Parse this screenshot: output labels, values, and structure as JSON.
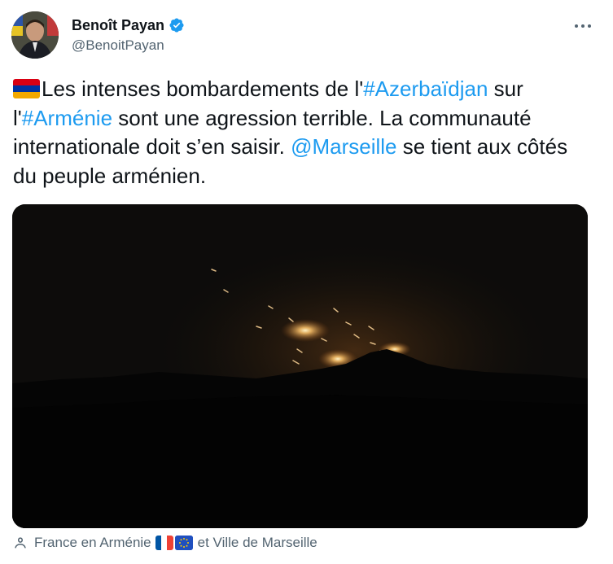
{
  "author": {
    "display_name": "Benoît Payan",
    "handle": "@BenoitPayan",
    "verified": true
  },
  "tweet": {
    "segments": [
      {
        "text": "Les intenses bombardements de l'",
        "kind": "text"
      },
      {
        "text": "#Azerbaïdjan",
        "kind": "hashtag"
      },
      {
        "text": " sur l'",
        "kind": "text"
      },
      {
        "text": "#Arménie",
        "kind": "hashtag"
      },
      {
        "text": " sont une agression terrible. La communauté internationale doit s’en saisir. ",
        "kind": "text"
      },
      {
        "text": "@Marseille",
        "kind": "mention"
      },
      {
        "text": " se tient aux côtés du peuple arménien.",
        "kind": "text"
      }
    ]
  },
  "tagged": {
    "first": "France en Arménie",
    "second": "et Ville de Marseille"
  },
  "colors": {
    "link": "#1d9bf0",
    "secondary_text": "#536471",
    "verified": "#1d9bf0",
    "flag_armenia": [
      "#d90012",
      "#0033a0",
      "#f2a800"
    ],
    "flag_france": [
      "#0055a4",
      "#ffffff",
      "#ef4135"
    ],
    "flag_eu": "#1f4fbf"
  },
  "icons": {
    "verified": "verified-badge-icon",
    "more": "more-horizontal-icon",
    "tag": "person-icon"
  }
}
